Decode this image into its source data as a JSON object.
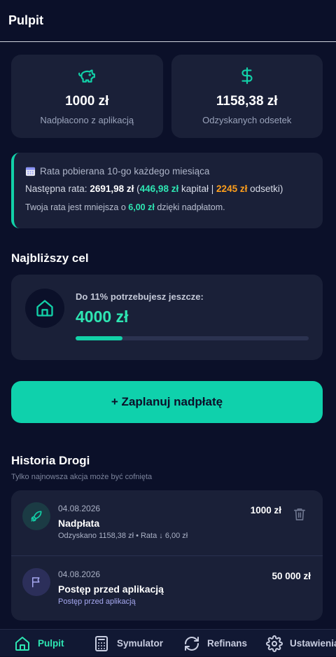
{
  "header": {
    "title": "Pulpit"
  },
  "stats": [
    {
      "icon": "piggy-bank-icon",
      "value": "1000 zł",
      "label": "Nadpłacono z aplikacją"
    },
    {
      "icon": "dollar-sign-icon",
      "value": "1158,38 zł",
      "label": "Odzyskanych odsetek"
    }
  ],
  "info": {
    "icon": "calendar-icon",
    "schedule": "Rata pobierana 10-go każdego miesiąca",
    "next_label": "Następna rata:",
    "next_amount": "2691,98 zł",
    "open_paren": "(",
    "capital_amount": "446,98 zł",
    "capital_label": "kapitał",
    "separator": "|",
    "interest_amount": "2245 zł",
    "interest_label": "odsetki)",
    "savings_prefix": "Twoja rata jest mniejsza o",
    "savings_amount": "6,00 zł",
    "savings_suffix": "dzięki nadpłatom."
  },
  "goal": {
    "section_title": "Najbliższy cel",
    "icon": "home-icon",
    "need_label": "Do 11% potrzebujesz jeszcze:",
    "amount": "4000 zł",
    "progress": 0.2
  },
  "cta": {
    "label": "+ Zaplanuj nadpłatę"
  },
  "history": {
    "title": "Historia Drogi",
    "subtitle": "Tylko najnowsza akcja może być cofnięta",
    "items": [
      {
        "icon": "rocket-icon",
        "date": "04.08.2026",
        "title": "Nadpłata",
        "detail": "Odzyskano 1158,38 zł • Rata ↓ 6,00 zł",
        "amount": "1000 zł",
        "deletable": true
      },
      {
        "icon": "flag-icon",
        "date": "04.08.2026",
        "title": "Postęp przed aplikacją",
        "detail": "Postęp przed aplikacją",
        "amount": "50 000 zł",
        "deletable": false
      }
    ]
  },
  "nav": [
    {
      "icon": "home-icon",
      "label": "Pulpit",
      "active": true
    },
    {
      "icon": "calculator-icon",
      "label": "Symulator",
      "active": false
    },
    {
      "icon": "refresh-icon",
      "label": "Refinans",
      "active": false
    },
    {
      "icon": "gear-icon",
      "label": "Ustawienia",
      "active": false
    }
  ],
  "colors": {
    "background": "#0b1029",
    "card": "#1a2038",
    "accent": "#12d1a8",
    "orange": "#ff9f1c"
  }
}
